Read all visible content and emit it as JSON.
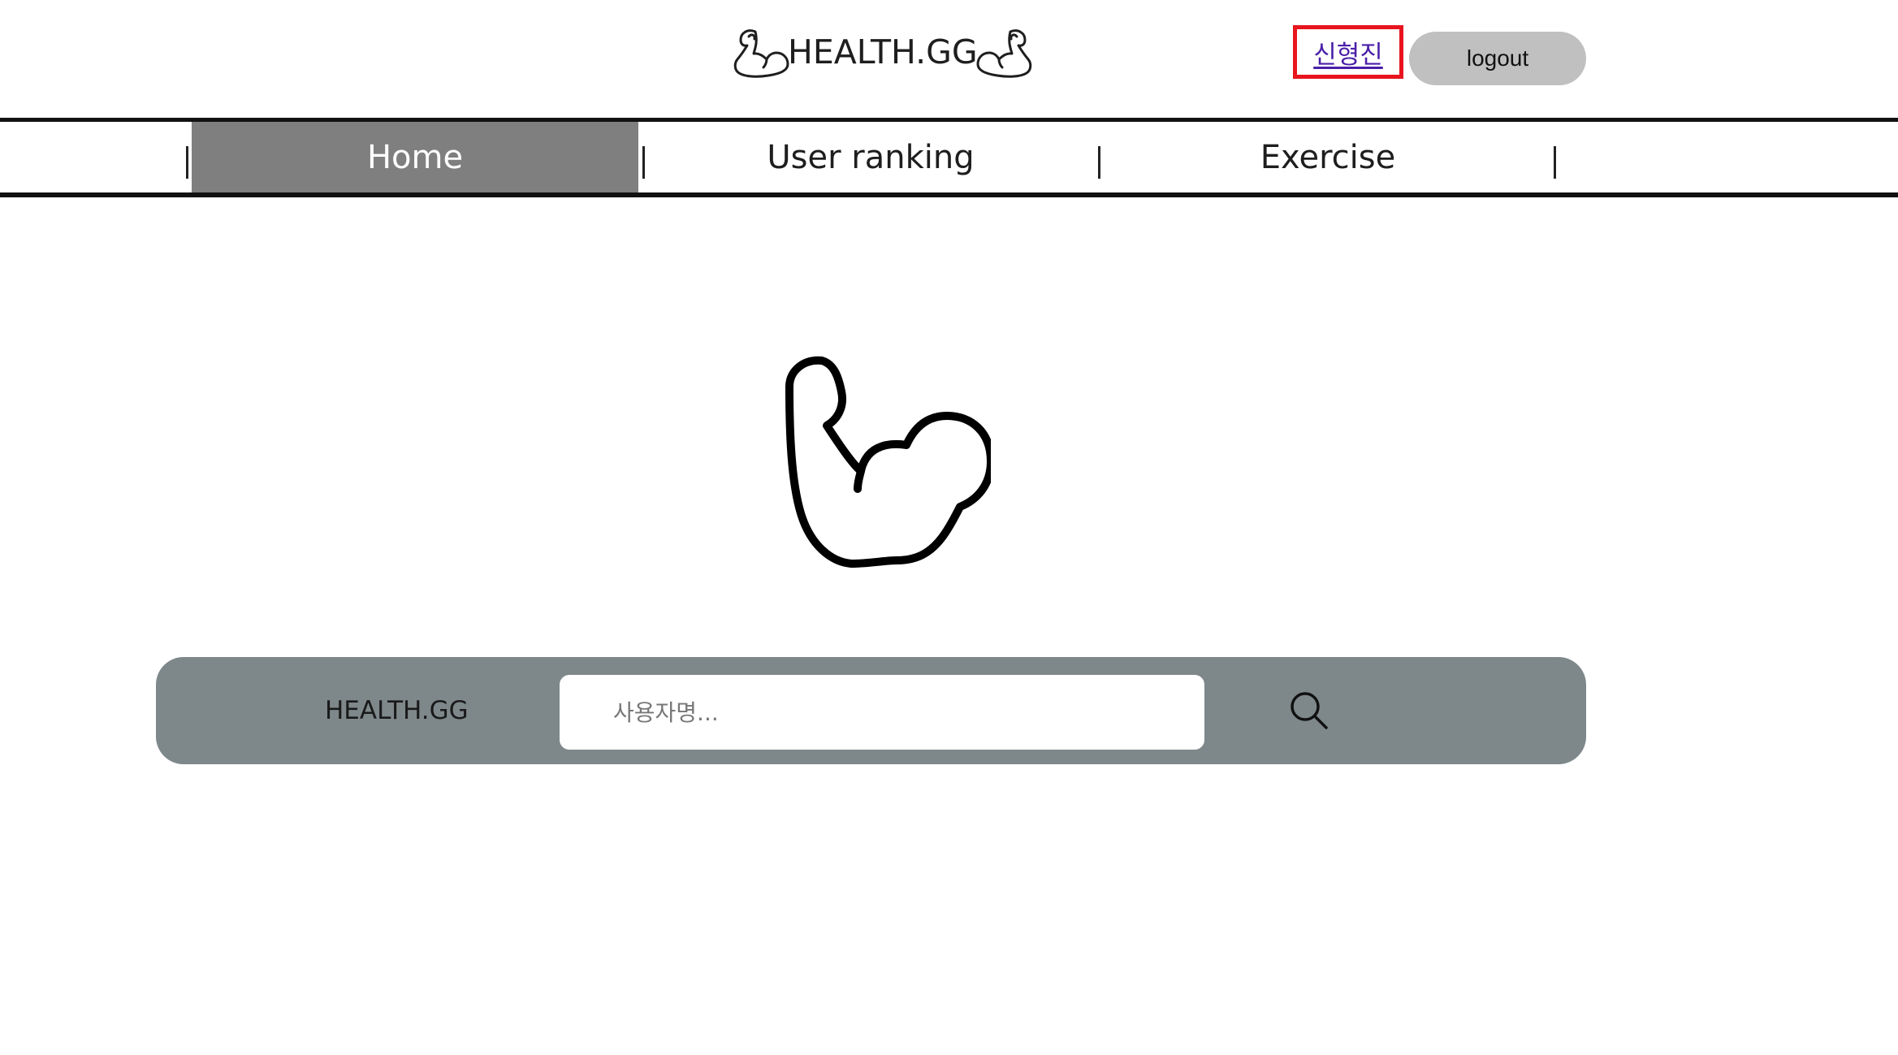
{
  "header": {
    "brand_text": "HEALTH.GG",
    "user_name": "신형진",
    "logout_label": "logout",
    "highlight_color": "#e8141e",
    "logo_icon": "flexed-biceps-icon"
  },
  "nav": {
    "items": [
      {
        "label": "Home",
        "active": true
      },
      {
        "label": "User ranking",
        "active": false
      },
      {
        "label": "Exercise",
        "active": false
      }
    ],
    "active_color": "#7f7f7f"
  },
  "hero": {
    "icon": "flexed-biceps-icon"
  },
  "search": {
    "brand_label": "HEALTH.GG",
    "placeholder": "사용자명...",
    "value": "",
    "button_icon": "search-icon",
    "bar_color": "#7e888b"
  }
}
